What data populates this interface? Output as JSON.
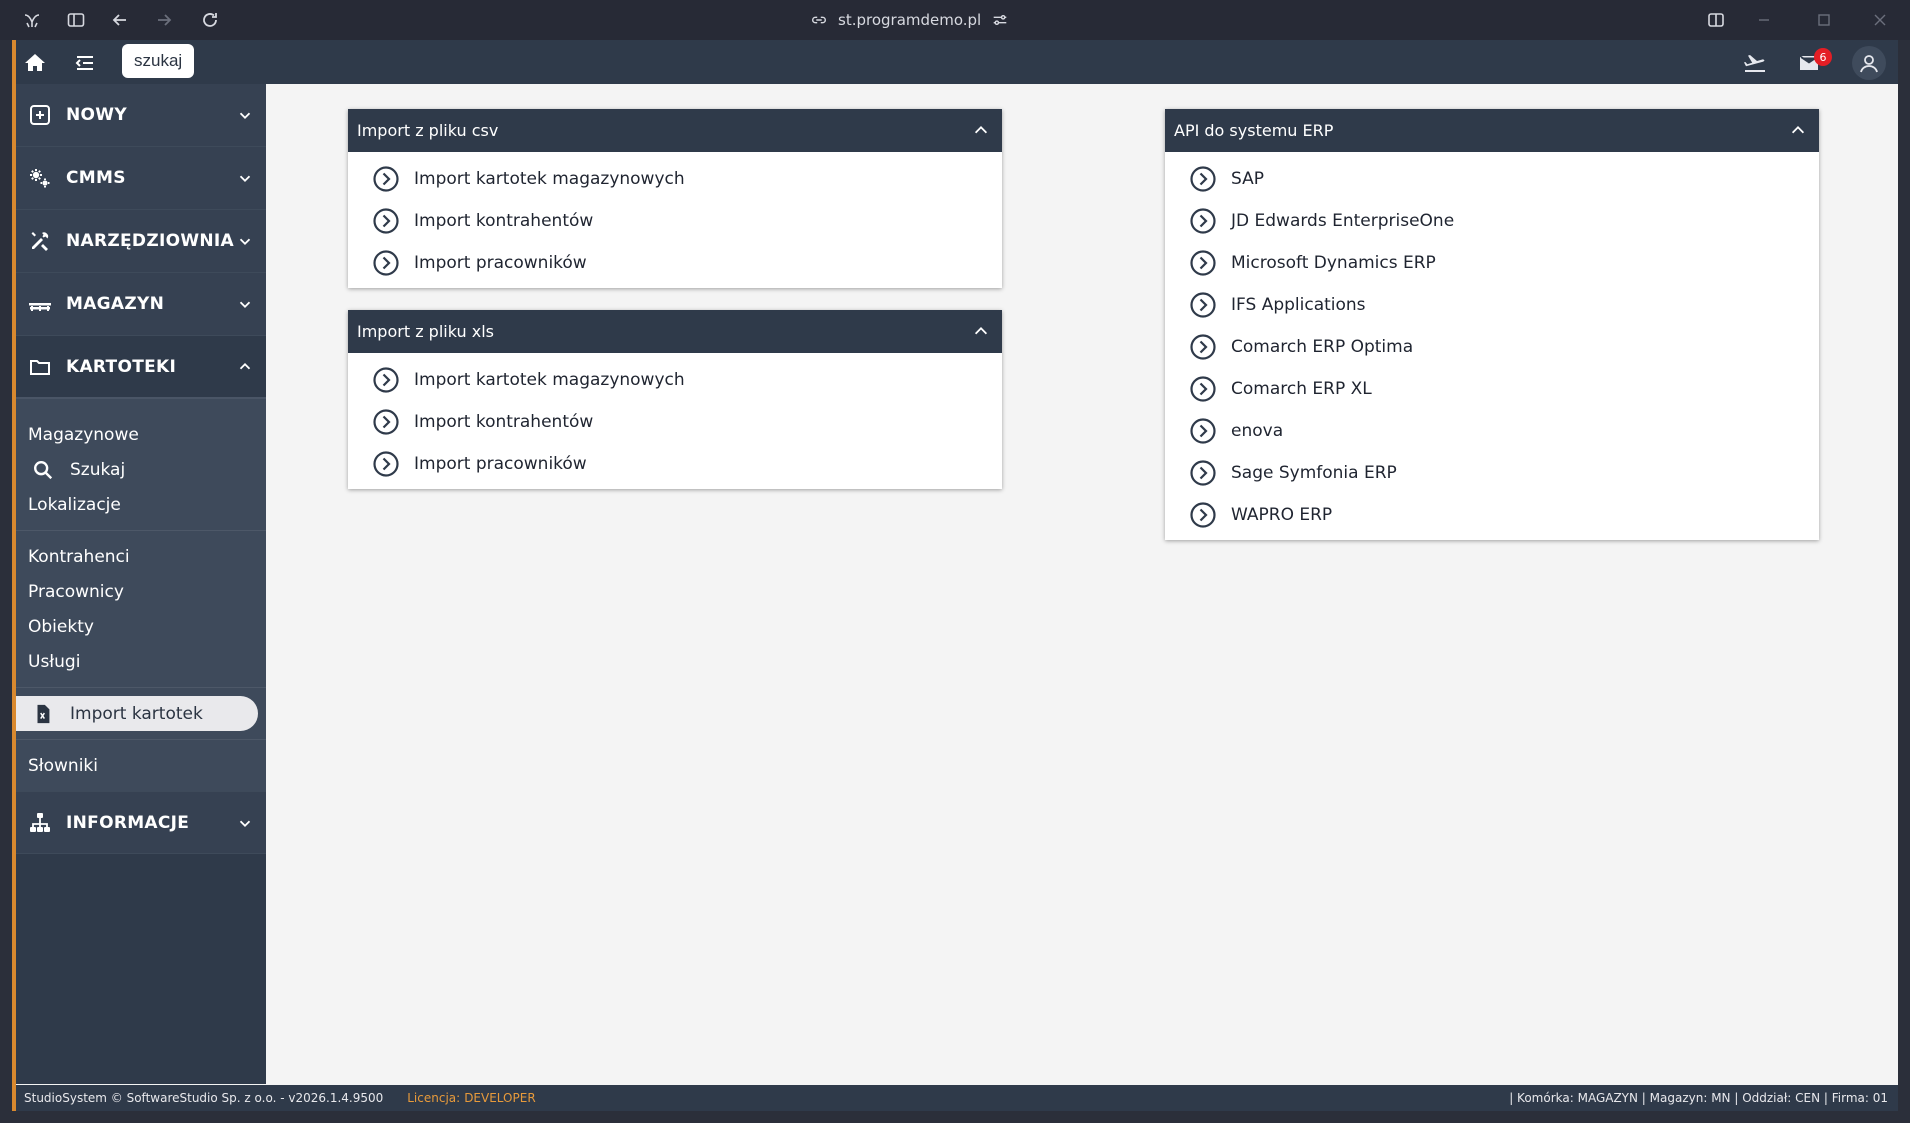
{
  "browser": {
    "url": "st.programdemo.pl"
  },
  "topbar": {
    "search_label": "szukaj",
    "mail_count": "6"
  },
  "sidebar": {
    "sections": [
      {
        "label": "NOWY",
        "icon": "plus-square-icon"
      },
      {
        "label": "CMMS",
        "icon": "gears-icon"
      },
      {
        "label": "NARZĘDZIOWNIA",
        "icon": "tools-icon"
      },
      {
        "label": "MAGAZYN",
        "icon": "warehouse-icon"
      },
      {
        "label": "KARTOTEKI",
        "icon": "folder-icon"
      }
    ],
    "sub_groups": [
      [
        "Magazynowe",
        "Szukaj",
        "Lokalizacje"
      ],
      [
        "Kontrahenci",
        "Pracownicy",
        "Obiekty",
        "Usługi"
      ],
      [
        "Import kartotek"
      ],
      [
        "Słowniki"
      ]
    ],
    "info_label": "INFORMACJE"
  },
  "cards": {
    "csv": {
      "title": "Import z pliku csv",
      "items": [
        "Import kartotek magazynowych",
        "Import kontrahentów",
        "Import pracowników"
      ]
    },
    "xls": {
      "title": "Import z pliku xls",
      "items": [
        "Import kartotek magazynowych",
        "Import kontrahentów",
        "Import pracowników"
      ]
    },
    "erp": {
      "title": "API do systemu ERP",
      "items": [
        "SAP",
        "JD Edwards EnterpriseOne",
        "Microsoft Dynamics ERP",
        "IFS Applications",
        "Comarch ERP Optima",
        "Comarch ERP XL",
        "enova",
        "Sage Symfonia ERP",
        "WAPRO ERP"
      ]
    }
  },
  "footer": {
    "copyright": "StudioSystem © SoftwareStudio Sp. z o.o. - v2026.1.4.9500",
    "license_label": "Licencja:",
    "license_value": "DEVELOPER",
    "status": "| Komórka: MAGAZYN | Magazyn: MN | Oddział: CEN | Firma: 01"
  },
  "colors": {
    "accent": "#d9892f",
    "header_bg": "#2f3a4a",
    "badge": "#e41e25"
  }
}
